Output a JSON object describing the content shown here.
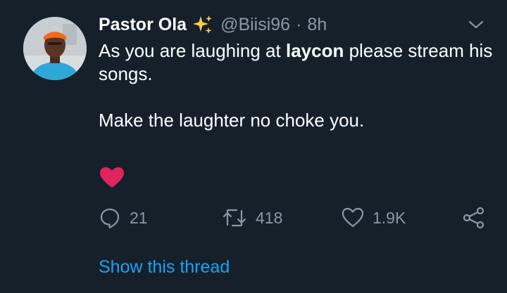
{
  "tweet": {
    "author": {
      "display_name": "Pastor Ola",
      "handle": "@Biisi96",
      "separator": "·",
      "time": "8h",
      "avatar": "profile-photo-orange-headband"
    },
    "text": {
      "line1_before": "As you are laughing at ",
      "line1_mention": "laycon",
      "line1_after": " please stream his songs.",
      "line2": "Make the laughter no choke you."
    },
    "emoji": "red-heart",
    "actions": {
      "reply_count": "21",
      "retweet_count": "418",
      "like_count": "1.9K"
    },
    "show_thread": "Show this thread"
  },
  "colors": {
    "background": "#15202b",
    "text": "#ffffff",
    "muted": "#8899a6",
    "link": "#1da1f2",
    "heart": "#e0245e",
    "sparkle": "#ffcc4d"
  }
}
